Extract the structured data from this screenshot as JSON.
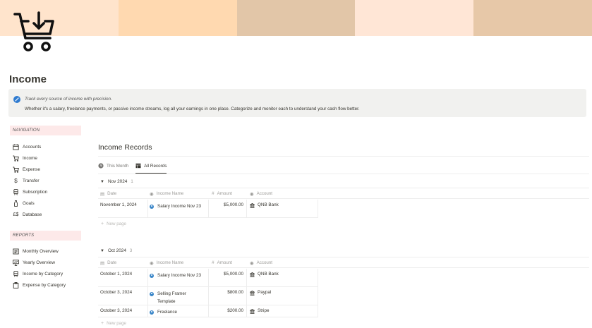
{
  "cover": {
    "colors": [
      "#ffe4cc",
      "#ffd9b0",
      "#e2c6a8",
      "#ffe6d6",
      "#e7c8a8"
    ]
  },
  "page": {
    "icon": "cart-download-icon",
    "title": "Income"
  },
  "callout": {
    "icon": "info-icon",
    "line1": "Track every source of income with precision.",
    "line2": "Whether it's a salary, freelance payments, or passive income streams, log all your earnings in one place. Categorize and monitor each to understand your cash flow better."
  },
  "sidebar": {
    "navigation_header": "NAVIGATION",
    "navigation": [
      {
        "label": "Accounts",
        "icon": "calendar-icon"
      },
      {
        "label": "Income",
        "icon": "cart-icon"
      },
      {
        "label": "Expense",
        "icon": "cart-icon"
      },
      {
        "label": "Transfer",
        "icon": "dollar-icon"
      },
      {
        "label": "Subscription",
        "icon": "train-icon"
      },
      {
        "label": "Goals",
        "icon": "bottle-icon"
      },
      {
        "label": "Database",
        "icon": "currency-exchange-icon"
      }
    ],
    "reports_header": "REPORTS",
    "reports": [
      {
        "label": "Monthly Overview",
        "icon": "list-icon"
      },
      {
        "label": "Yearly Overview",
        "icon": "presentation-icon"
      },
      {
        "label": "Income by Category",
        "icon": "train-icon"
      },
      {
        "label": "Expense by Category",
        "icon": "clipboard-icon"
      }
    ]
  },
  "database": {
    "title": "Income Records",
    "views": [
      {
        "label": "This Month",
        "icon": "clock-icon",
        "active": false
      },
      {
        "label": "All Records",
        "icon": "table-icon",
        "active": true
      }
    ],
    "columns": {
      "date": "Date",
      "name": "Income Name",
      "amount": "Amount",
      "account": "Account"
    },
    "new_page": "New page",
    "groups": [
      {
        "label": "Nov 2024",
        "count": "1",
        "rows": [
          {
            "date": "November 1, 2024",
            "name": "Salary Income Nov 23",
            "amount": "$5,000.00",
            "account": "QNB Bank"
          }
        ]
      },
      {
        "label": "Oct 2024",
        "count": "3",
        "rows": [
          {
            "date": "October 1, 2024",
            "name": "Salary Income Nov 23",
            "amount": "$5,000.00",
            "account": "QNB Bank"
          },
          {
            "date": "October 3, 2024",
            "name": "Selling Framer Template",
            "amount": "$800.00",
            "account": "Paypal"
          },
          {
            "date": "October 3, 2024",
            "name": "Freelance",
            "amount": "$200.00",
            "account": "Stripe"
          }
        ]
      }
    ]
  }
}
